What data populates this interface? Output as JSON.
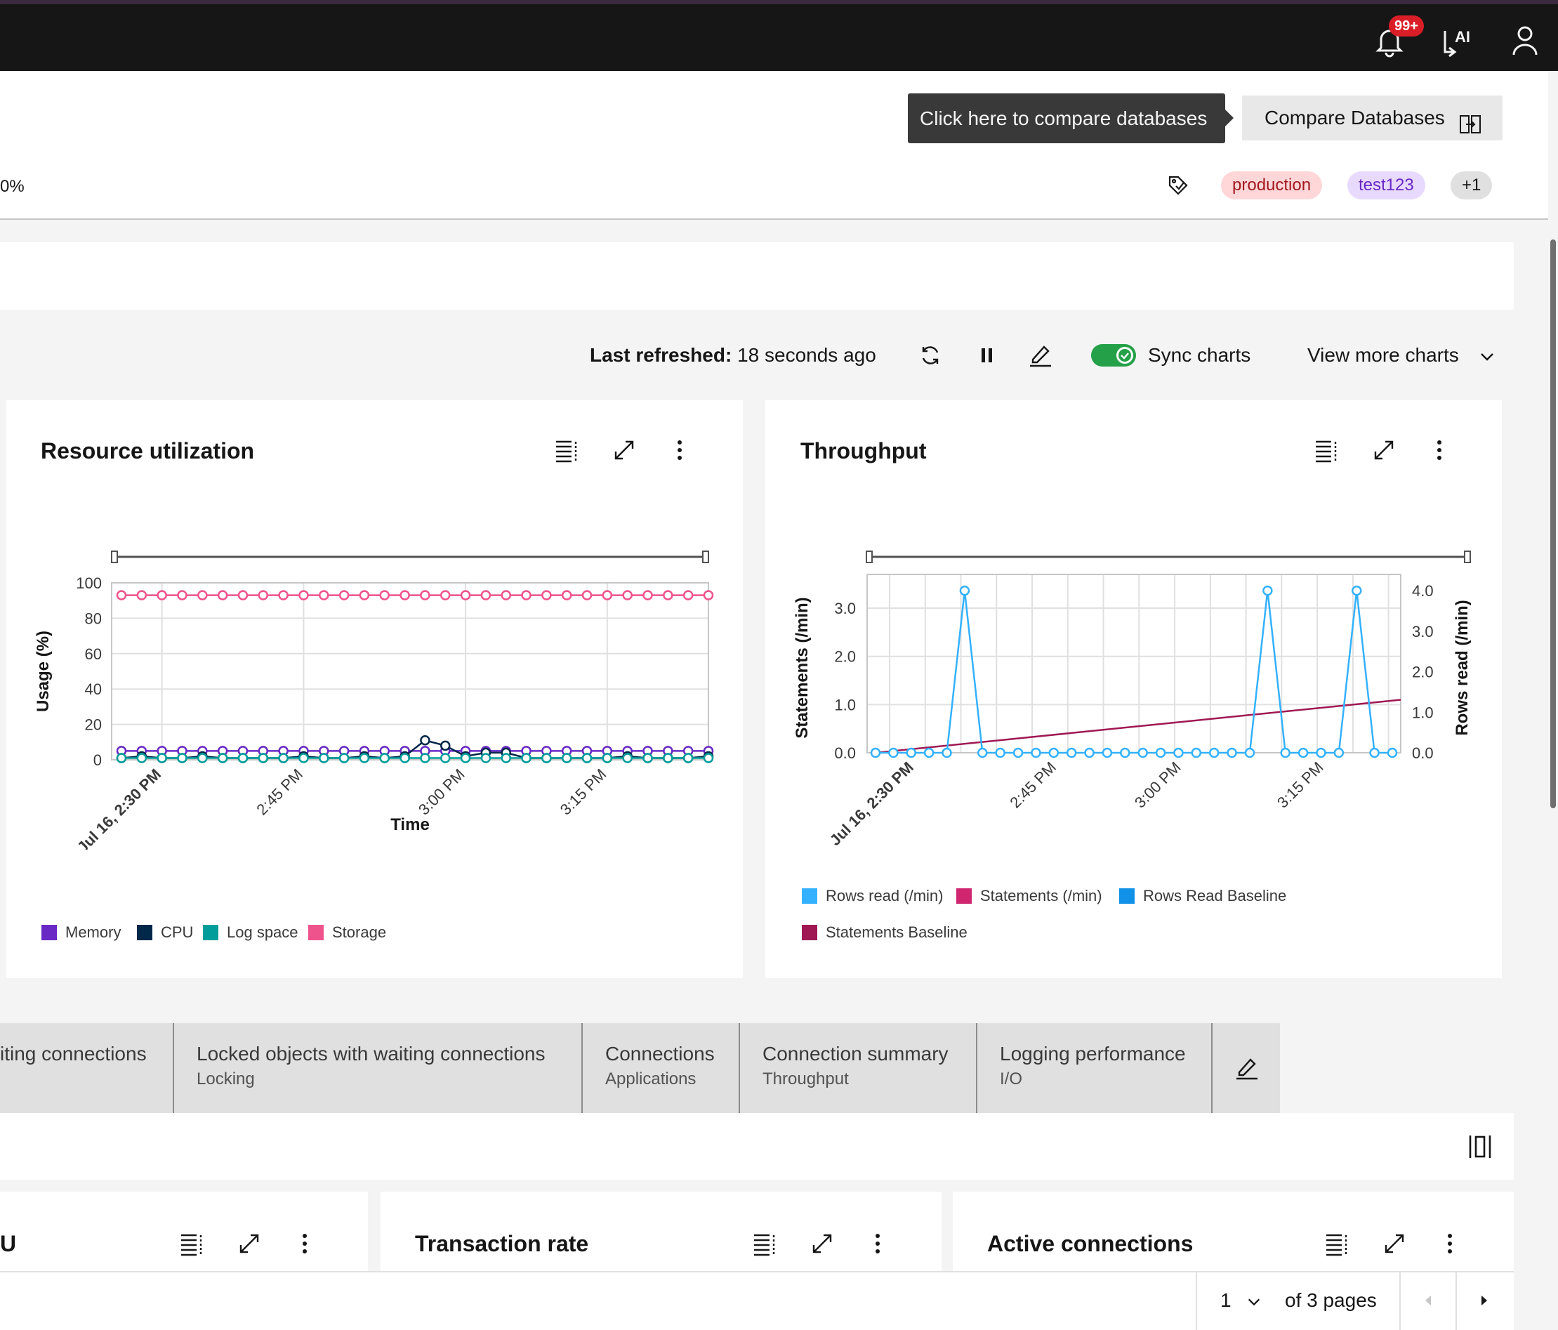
{
  "topbar": {
    "notifications_badge": "99+"
  },
  "header": {
    "tooltip": "Click here to compare databases",
    "compare_button": "Compare Databases",
    "percent_fragment": "0%",
    "tags": [
      "production",
      "test123",
      "+1"
    ]
  },
  "toolbar": {
    "last_refreshed_label": "Last refreshed:",
    "last_refreshed_value": "18 seconds ago",
    "sync_label": "Sync charts",
    "view_more": "View more charts"
  },
  "cards": {
    "resource": {
      "title": "Resource utilization"
    },
    "throughput": {
      "title": "Throughput"
    },
    "cpu_fragment": {
      "title": "U"
    },
    "transaction": {
      "title": "Transaction rate"
    },
    "active": {
      "title": "Active connections"
    }
  },
  "chart_data": [
    {
      "type": "line",
      "title": "Resource utilization",
      "xlabel": "Time",
      "ylabel": "Usage (%)",
      "ylim": [
        0,
        100
      ],
      "x_ticks": [
        "Jul 16, 2:30 PM",
        "2:45 PM",
        "3:00 PM",
        "3:15 PM"
      ],
      "y_ticks": [
        "0",
        "20",
        "40",
        "60",
        "80",
        "100"
      ],
      "grid": true,
      "legend": "bottom-left",
      "series": [
        {
          "name": "Memory",
          "color": "#6929c4",
          "values": [
            5,
            5,
            5,
            5,
            5,
            5,
            5,
            5,
            5,
            5,
            5,
            5,
            5,
            5,
            5,
            5,
            5,
            5,
            5,
            5,
            5,
            5,
            5,
            5,
            5,
            5,
            5,
            5,
            5,
            5
          ]
        },
        {
          "name": "CPU",
          "color": "#012749",
          "values": [
            1,
            2,
            1,
            1,
            2,
            1,
            1,
            1,
            1,
            2,
            1,
            1,
            2,
            1,
            2,
            11,
            8,
            2,
            4,
            4,
            1,
            1,
            1,
            1,
            1,
            2,
            1,
            1,
            1,
            2
          ]
        },
        {
          "name": "Log space",
          "color": "#009d9a",
          "values": [
            1,
            1,
            1,
            1,
            1,
            1,
            1,
            1,
            1,
            1,
            1,
            1,
            1,
            1,
            1,
            1,
            1,
            1,
            1,
            1,
            1,
            1,
            1,
            1,
            1,
            1,
            1,
            1,
            1,
            1
          ]
        },
        {
          "name": "Storage",
          "color": "#ee538b",
          "values": [
            93,
            93,
            93,
            93,
            93,
            93,
            93,
            93,
            93,
            93,
            93,
            93,
            93,
            93,
            93,
            93,
            93,
            93,
            93,
            93,
            93,
            93,
            93,
            93,
            93,
            93,
            93,
            93,
            93,
            93
          ]
        }
      ]
    },
    {
      "type": "line",
      "title": "Throughput",
      "ylabel": "Statements (/min)",
      "y2label": "Rows read (/min)",
      "ylim": [
        0,
        3.7
      ],
      "y2lim": [
        0,
        4.4
      ],
      "x_ticks": [
        "Jul 16, 2:30 PM",
        "2:45 PM",
        "3:00 PM",
        "3:15 PM"
      ],
      "y_ticks": [
        "0.0",
        "1.0",
        "2.0",
        "3.0"
      ],
      "y2_ticks": [
        "0.0",
        "1.0",
        "2.0",
        "3.0",
        "4.0"
      ],
      "grid": true,
      "legend": "bottom-left",
      "series": [
        {
          "name": "Rows read (/min)",
          "color": "#33b1ff",
          "axis": "right",
          "values": [
            0,
            0,
            0,
            0,
            0,
            4,
            0,
            0,
            0,
            0,
            0,
            0,
            0,
            0,
            0,
            0,
            0,
            0,
            0,
            0,
            0,
            0,
            4,
            0,
            0,
            0,
            0,
            4,
            0,
            0
          ]
        },
        {
          "name": "Statements (/min)",
          "color": "#d02670",
          "values": []
        },
        {
          "name": "Rows Read Baseline",
          "color": "#1192e8",
          "values": []
        },
        {
          "name": "Statements Baseline",
          "color": "#9f1853",
          "line": [
            0,
            1.1
          ]
        }
      ]
    }
  ],
  "tabs": [
    {
      "title": "iting connections",
      "subtitle": ""
    },
    {
      "title": "Locked objects with waiting connections",
      "subtitle": "Locking"
    },
    {
      "title": "Connections",
      "subtitle": "Applications"
    },
    {
      "title": "Connection summary",
      "subtitle": "Throughput"
    },
    {
      "title": "Logging performance",
      "subtitle": "I/O"
    }
  ],
  "pagination": {
    "page": "1",
    "of_pages": "of 3 pages"
  }
}
